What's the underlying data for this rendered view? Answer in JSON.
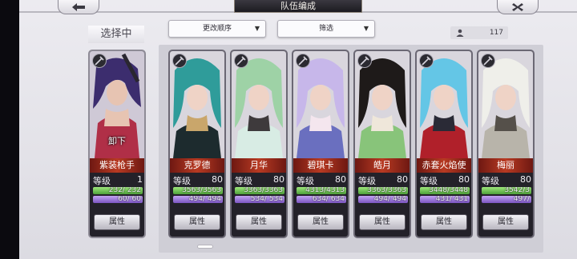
{
  "header": {
    "title": "队伍编成",
    "back_icon": "arrow-left-icon",
    "close_icon": "close-icon"
  },
  "selected_label": "选择中",
  "filters": {
    "sort_label": "更改顺序",
    "filter_label": "筛选"
  },
  "member_count": "117",
  "selected_card": {
    "name": "紫装枪手",
    "unload_label": "卸下",
    "level_label": "等级",
    "level": "1",
    "hp_text": "232/ 232",
    "hp_fraction": 1.0,
    "mp_text": "60/ 60",
    "mp_fraction": 1.0,
    "attr_label": "属性"
  },
  "cards": [
    {
      "name": "克罗德",
      "level_label": "等级",
      "level": "80",
      "hp_text": "3563/3563",
      "hp_fraction": 1.0,
      "mp_text": "494/ 494",
      "mp_fraction": 1.0,
      "attr_label": "属性",
      "colors": [
        "#2f9c9a",
        "#1d2b2e",
        "#c9a66b"
      ]
    },
    {
      "name": "月华",
      "level_label": "等级",
      "level": "80",
      "hp_text": "3363/3363",
      "hp_fraction": 1.0,
      "mp_text": "534/ 534",
      "mp_fraction": 1.0,
      "attr_label": "属性",
      "colors": [
        "#9ed2a6",
        "#d8ece4",
        "#3e3a3c"
      ]
    },
    {
      "name": "碧琪卡",
      "level_label": "等级",
      "level": "80",
      "hp_text": "4313/4313",
      "hp_fraction": 1.0,
      "mp_text": "634/ 634",
      "mp_fraction": 1.0,
      "attr_label": "属性",
      "colors": [
        "#c7b7ea",
        "#6a6fbf",
        "#f4e6ee"
      ]
    },
    {
      "name": "皓月",
      "level_label": "等级",
      "level": "80",
      "hp_text": "3363/3363",
      "hp_fraction": 1.0,
      "mp_text": "494/ 494",
      "mp_fraction": 1.0,
      "attr_label": "属性",
      "colors": [
        "#1e1a19",
        "#88c47a",
        "#efe7da"
      ]
    },
    {
      "name": "赤套火焰使",
      "level_label": "等级",
      "level": "80",
      "hp_text": "3448/3448",
      "hp_fraction": 1.0,
      "mp_text": "431/ 431",
      "mp_fraction": 1.0,
      "attr_label": "属性",
      "colors": [
        "#64c6e6",
        "#b0202a",
        "#2a2a36"
      ]
    },
    {
      "name": "梅丽",
      "level_label": "等级",
      "level": "80",
      "hp_text": "3542/3",
      "hp_fraction": 1.0,
      "mp_text": "497/",
      "mp_fraction": 1.0,
      "attr_label": "属性",
      "colors": [
        "#efefea",
        "#b8b4aa",
        "#55504a"
      ]
    }
  ],
  "selected_colors": [
    "#3c2d6e",
    "#b02f47",
    "#e7c4b2"
  ]
}
